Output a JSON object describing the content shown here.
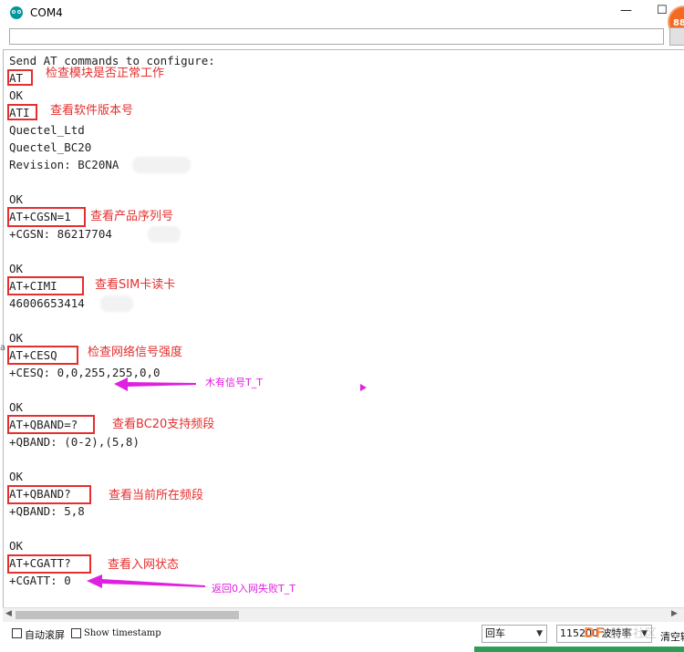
{
  "window": {
    "title": "COM4",
    "minimize": "—",
    "maximize": "☐",
    "badge": "88"
  },
  "send": {
    "value": ""
  },
  "monitor": {
    "lines": [
      "Send AT commands to configure:",
      "AT",
      "OK",
      "ATI",
      "Quectel_Ltd",
      "Quectel_BC20",
      "Revision: BC20NA    A0",
      "",
      "OK",
      "AT+CGSN=1",
      "+CGSN: 86217704      3",
      "",
      "OK",
      "AT+CIMI",
      "46006653414",
      "",
      "OK",
      "AT+CESQ",
      "+CESQ: 0,0,255,255,0,0",
      "",
      "OK",
      "AT+QBAND=?",
      "+QBAND: (0-2),(5,8)",
      "",
      "OK",
      "AT+QBAND?",
      "+QBAND: 5,8",
      "",
      "OK",
      "AT+CGATT?",
      "+CGATT: 0"
    ]
  },
  "annotations": {
    "at": "检查模块是否正常工作",
    "ati": "查看软件版本号",
    "cgsn": "查看产品序列号",
    "cimi": "查看SIM卡读卡",
    "cesq": "检查网络信号强度",
    "qband_q": "查看BC20支持频段",
    "qband": "查看当前所在频段",
    "cgatt": "查看入网状态",
    "no_signal": "木有信号T_T",
    "attach_fail": "返回0入网失败T_T"
  },
  "bottom": {
    "autoscroll": "自动滚屏",
    "timestamp": "Show timestamp",
    "line_ending": "回车",
    "baud": "115200 波特率",
    "clear": "清空输出"
  },
  "watermark": {
    "brand": "DF",
    "sub": "创客社区"
  },
  "colors": {
    "annotation_red": "#e52e2e",
    "annotation_magenta": "#e020e0",
    "arduino_teal": "#00979c"
  }
}
